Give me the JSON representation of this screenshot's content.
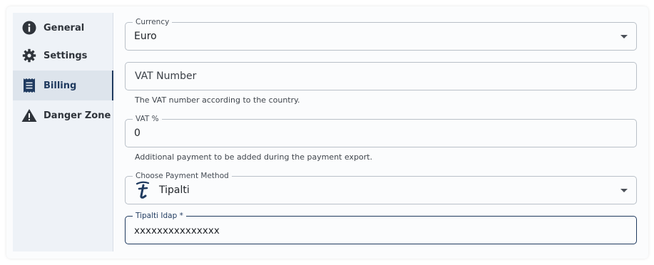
{
  "sidebar": {
    "items": [
      {
        "label": "General",
        "icon": "info-icon",
        "active": false
      },
      {
        "label": "Settings",
        "icon": "gear-icon",
        "active": false
      },
      {
        "label": "Billing",
        "icon": "receipt-icon",
        "active": true
      },
      {
        "label": "Danger Zone",
        "icon": "warning-icon",
        "active": false
      }
    ]
  },
  "form": {
    "currency": {
      "label": "Currency",
      "value": "Euro"
    },
    "vat_number": {
      "placeholder": "VAT Number",
      "helper": "The VAT number according to the country."
    },
    "vat_percent": {
      "label": "VAT %",
      "value": "0",
      "helper": "Additional payment to be added during the payment export."
    },
    "payment_method": {
      "label": "Choose Payment Method",
      "value": "Tipalti",
      "icon": "tipalti-logo-icon"
    },
    "tipalti_idap": {
      "label": "Tipalti Idap *",
      "value": "xxxxxxxxxxxxxxx"
    }
  },
  "colors": {
    "accent": "#1f3a5f",
    "sidebar_bg": "#eef2f7",
    "active_bg": "#dde4ec"
  }
}
